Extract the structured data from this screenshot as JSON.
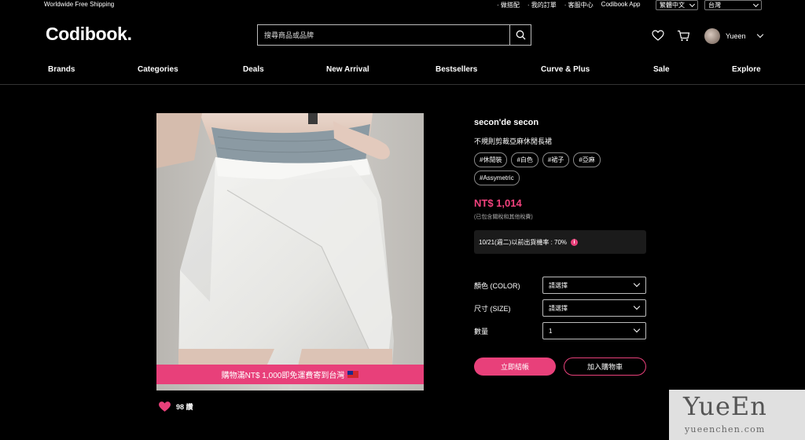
{
  "topbar": {
    "shipping": "Worldwide Free Shipping",
    "links": [
      "· 做搭配",
      "· 我的訂單",
      "· 客服中心",
      "Codibook App"
    ],
    "language": "繁體中文",
    "region": "台灣"
  },
  "header": {
    "logo": "Codibook.",
    "search_placeholder": "搜尋商品或品牌",
    "user_name": "Yueen"
  },
  "nav": [
    "Brands",
    "Categories",
    "Deals",
    "New Arrival",
    "Bestsellers",
    "Curve & Plus",
    "Sale",
    "Explore"
  ],
  "product": {
    "promo_banner": "購物滿NT$ 1,000即免運費寄到台灣",
    "likes": "98 讚",
    "brand": "secon'de secon",
    "name": "不規則剪裁亞麻休閒長裙",
    "tags": [
      "#休閒裝",
      "#白色",
      "#裙子",
      "#亞麻",
      "#Assymetric"
    ],
    "price": "NT$ 1,014",
    "price_note": "(已包含關稅和其他稅費)",
    "shipping_rate": "10/21(週二)以前出貨機率 : 70%",
    "options": [
      {
        "label": "顏色 (COLOR)",
        "value": "請選擇"
      },
      {
        "label": "尺寸 (SIZE)",
        "value": "請選擇"
      },
      {
        "label": "數量",
        "value": "1"
      }
    ],
    "buy_button": "立即結帳",
    "cart_button": "加入購物車"
  },
  "watermark": {
    "title": "YueEn",
    "url": "yueenchen.com"
  },
  "colors": {
    "accent": "#e8407a",
    "price": "#f2427d",
    "background": "#000000"
  }
}
